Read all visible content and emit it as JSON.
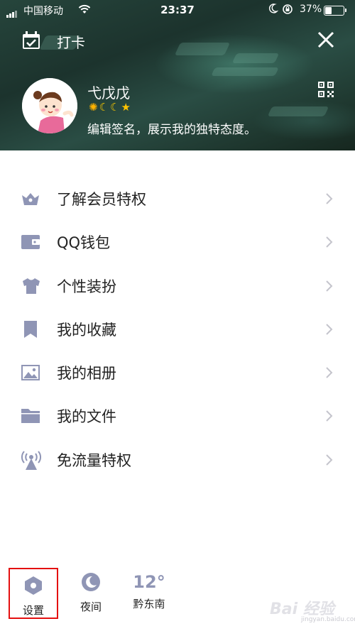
{
  "status_bar": {
    "carrier": "中国移动",
    "time": "23:37",
    "battery_text": "37%",
    "battery_level": 0.37
  },
  "header": {
    "checkin_label": "打卡",
    "nickname": "弋戊戊",
    "signature": "编辑签名，展示我的独特态度。",
    "level_badges": [
      "sun-icon",
      "moon-icon",
      "moon-icon",
      "star-icon"
    ]
  },
  "menu": {
    "items": [
      {
        "label": "了解会员特权",
        "icon": "crown-icon"
      },
      {
        "label": "QQ钱包",
        "icon": "wallet-icon"
      },
      {
        "label": "个性装扮",
        "icon": "shirt-icon"
      },
      {
        "label": "我的收藏",
        "icon": "bookmark-icon"
      },
      {
        "label": "我的相册",
        "icon": "photo-icon"
      },
      {
        "label": "我的文件",
        "icon": "folder-icon"
      },
      {
        "label": "免流量特权",
        "icon": "antenna-icon"
      }
    ]
  },
  "bottom_bar": {
    "settings_label": "设置",
    "night_label": "夜间",
    "temperature": "12°",
    "city": "黔东南"
  },
  "watermark": {
    "text": "Bai 经验",
    "sub": "jingyan.baidu.com"
  },
  "colors": {
    "icon_gray": "#8f95b5",
    "chevron": "#c4c4cc",
    "highlight_box": "#e41010",
    "header_bg": "#1f3a33"
  }
}
